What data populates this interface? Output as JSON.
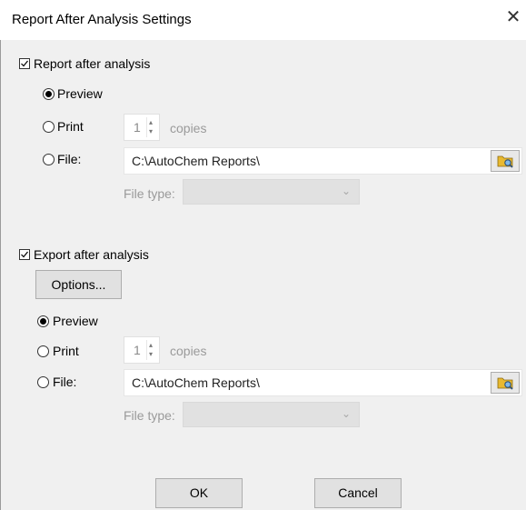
{
  "window": {
    "title": "Report After Analysis Settings",
    "close_glyph": "✕"
  },
  "report": {
    "checkbox_label": "Report after analysis",
    "checked": true,
    "preview_label": "Preview",
    "print_label": "Print",
    "file_label": "File:",
    "selected": "Preview",
    "copies_value": "1",
    "copies_label": "copies",
    "file_path": "C:\\AutoChem Reports\\",
    "file_type_label": "File type:",
    "file_type_value": ""
  },
  "export": {
    "checkbox_label": "Export after analysis",
    "checked": true,
    "options_button": "Options...",
    "preview_label": "Preview",
    "print_label": "Print",
    "file_label": "File:",
    "selected": "Preview",
    "copies_value": "1",
    "copies_label": "copies",
    "file_path": "C:\\AutoChem Reports\\",
    "file_type_label": "File type:",
    "file_type_value": ""
  },
  "buttons": {
    "ok": "OK",
    "cancel": "Cancel"
  },
  "icons": {
    "browse": "folder-search-icon",
    "spin_up": "▴",
    "spin_down": "▾",
    "dropdown": "⌄"
  },
  "colors": {
    "window_bg": "#f0f0f0",
    "titlebar_bg": "#ffffff",
    "disabled_text": "#9a9a9a"
  }
}
